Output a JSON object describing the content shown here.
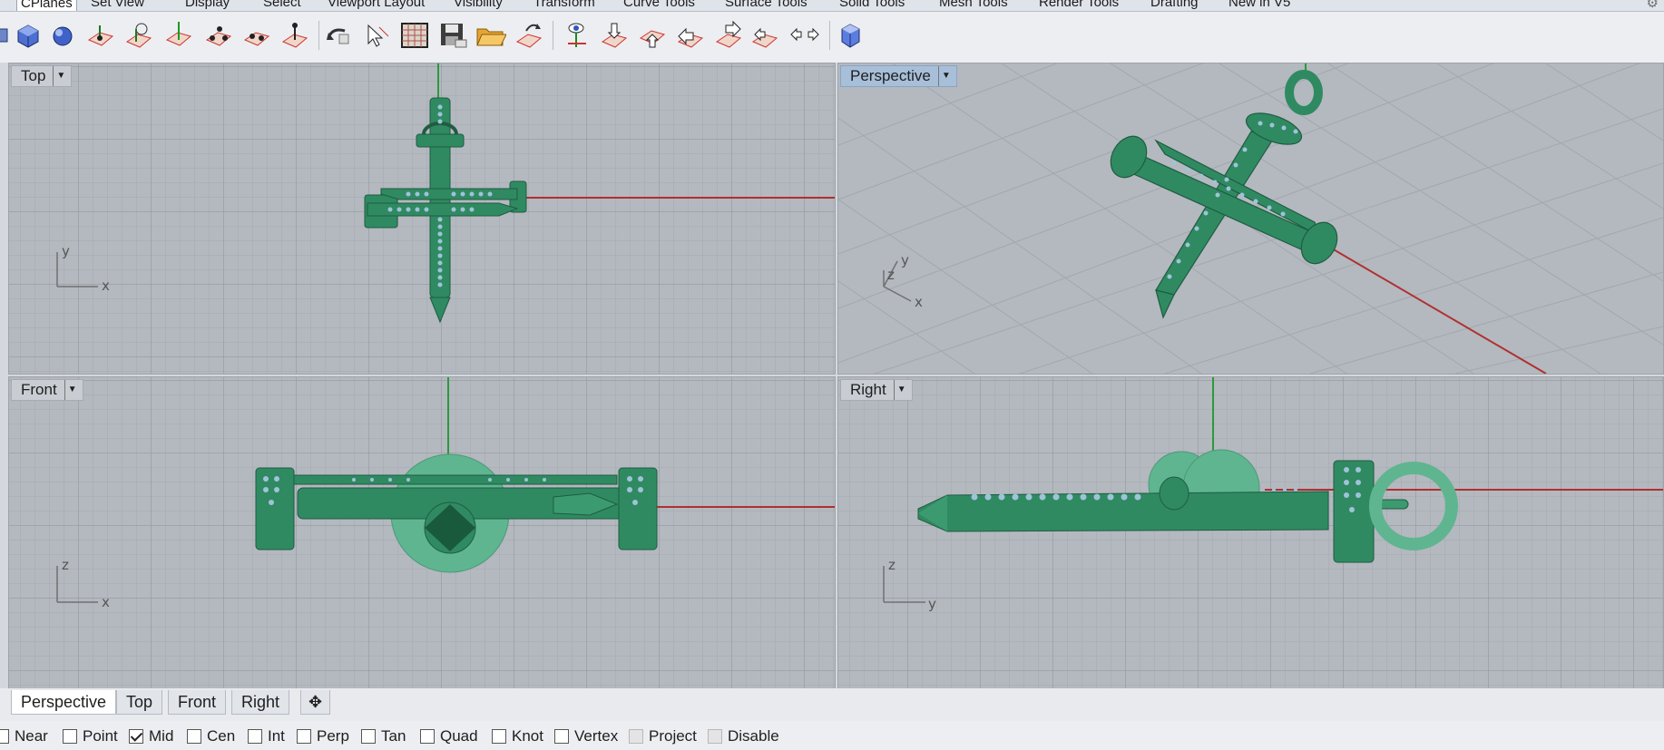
{
  "toolbar_tabs": {
    "items": [
      "CPlanes",
      "Set View",
      "Display",
      "Select",
      "Viewport Layout",
      "Visibility",
      "Transform",
      "Curve Tools",
      "Surface Tools",
      "Solid Tools",
      "Mesh Tools",
      "Render Tools",
      "Drafting",
      "New in V5"
    ],
    "active_index": 0
  },
  "toolbar_icons": [
    "box-icon",
    "sphere-icon",
    "cplane-icon",
    "cplane-rotate-icon",
    "cplane-world-icon",
    "cplane-3pt-icon",
    "cplane-object-icon",
    "cplane-elevation-icon",
    "undo-view-icon",
    "select-icon",
    "grid-icon",
    "save-icon",
    "open-folder-icon",
    "named-cplane-icon",
    "cplane-view-icon",
    "cplane-top-icon",
    "cplane-bottom-icon",
    "cplane-left-icon",
    "cplane-right-icon",
    "cplane-front-back-icon",
    "cube-icon"
  ],
  "viewports": {
    "top": {
      "label": "Top",
      "axis_h": "x",
      "axis_v": "y"
    },
    "perspective": {
      "label": "Perspective",
      "axis_x": "x",
      "axis_y": "y",
      "axis_z": "z"
    },
    "front": {
      "label": "Front",
      "axis_h": "x",
      "axis_v": "z"
    },
    "right": {
      "label": "Right",
      "axis_h": "y",
      "axis_v": "z"
    }
  },
  "viewport_tabs": {
    "items": [
      "Perspective",
      "Top",
      "Front",
      "Right"
    ],
    "active": "Perspective",
    "add_icon": "plus-icon"
  },
  "osnap": {
    "items": [
      {
        "label": "Near",
        "checked": false,
        "disabled": false
      },
      {
        "label": "Point",
        "checked": false,
        "disabled": false
      },
      {
        "label": "Mid",
        "checked": true,
        "disabled": false
      },
      {
        "label": "Cen",
        "checked": false,
        "disabled": false
      },
      {
        "label": "Int",
        "checked": false,
        "disabled": false
      },
      {
        "label": "Perp",
        "checked": false,
        "disabled": false
      },
      {
        "label": "Tan",
        "checked": false,
        "disabled": false
      },
      {
        "label": "Quad",
        "checked": false,
        "disabled": false
      },
      {
        "label": "Knot",
        "checked": false,
        "disabled": false
      },
      {
        "label": "Vertex",
        "checked": false,
        "disabled": false
      },
      {
        "label": "Project",
        "checked": false,
        "disabled": true
      },
      {
        "label": "Disable",
        "checked": false,
        "disabled": true
      }
    ]
  },
  "colors": {
    "model": "#2f8a62",
    "model_dark": "#1f6a47",
    "model_light": "#5fb58f",
    "gem": "#9fc3d8",
    "x_axis": "#b03030",
    "y_axis": "#2c9a3a",
    "viewport_bg": "#b4b8bf",
    "active_label": "#a7bfd9"
  }
}
